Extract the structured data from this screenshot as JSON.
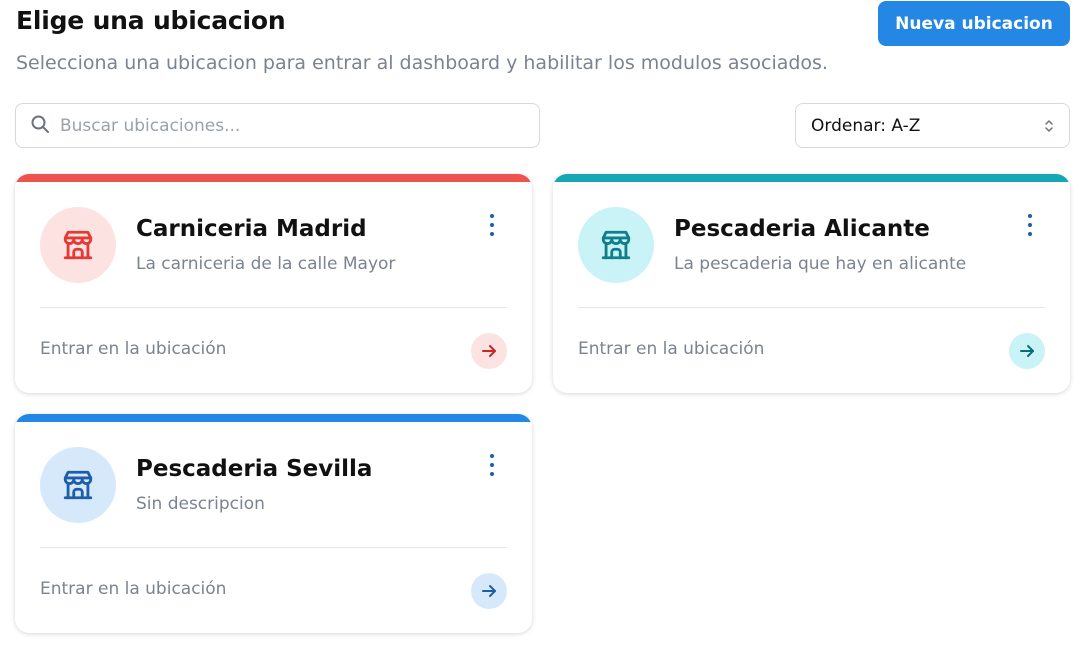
{
  "header": {
    "title": "Elige una ubicacion",
    "subtitle": "Selecciona una ubicacion para entrar al dashboard y habilitar los modulos asociados.",
    "new_button_label": "Nueva ubicacion"
  },
  "search": {
    "placeholder": "Buscar ubicaciones...",
    "value": ""
  },
  "sort": {
    "label": "Ordenar: A-Z"
  },
  "cards": [
    {
      "name": "Carniceria Madrid",
      "description": "La carniceria de la calle Mayor",
      "enter_label": "Entrar en la ubicación",
      "accent": "#ef5350",
      "avatar_bg": "#fde2e2",
      "icon_color": "#e53935",
      "arrow_bg": "#fde2e2",
      "arrow_color": "#c62828",
      "icon": "store-icon"
    },
    {
      "name": "Pescaderia Alicante",
      "description": "La pescaderia que hay en alicante",
      "enter_label": "Entrar en la ubicación",
      "accent": "#16a6b6",
      "avatar_bg": "#c9f3f6",
      "icon_color": "#0f7f8c",
      "arrow_bg": "#c9f3f6",
      "arrow_color": "#0c6b76",
      "icon": "store-icon"
    },
    {
      "name": "Pescaderia Sevilla",
      "description": "Sin descripcion",
      "enter_label": "Entrar en la ubicación",
      "accent": "#2487e4",
      "avatar_bg": "#d6e9fb",
      "icon_color": "#1e5ea8",
      "arrow_bg": "#d6e9fb",
      "arrow_color": "#1e5ea8",
      "icon": "store-icon"
    }
  ]
}
